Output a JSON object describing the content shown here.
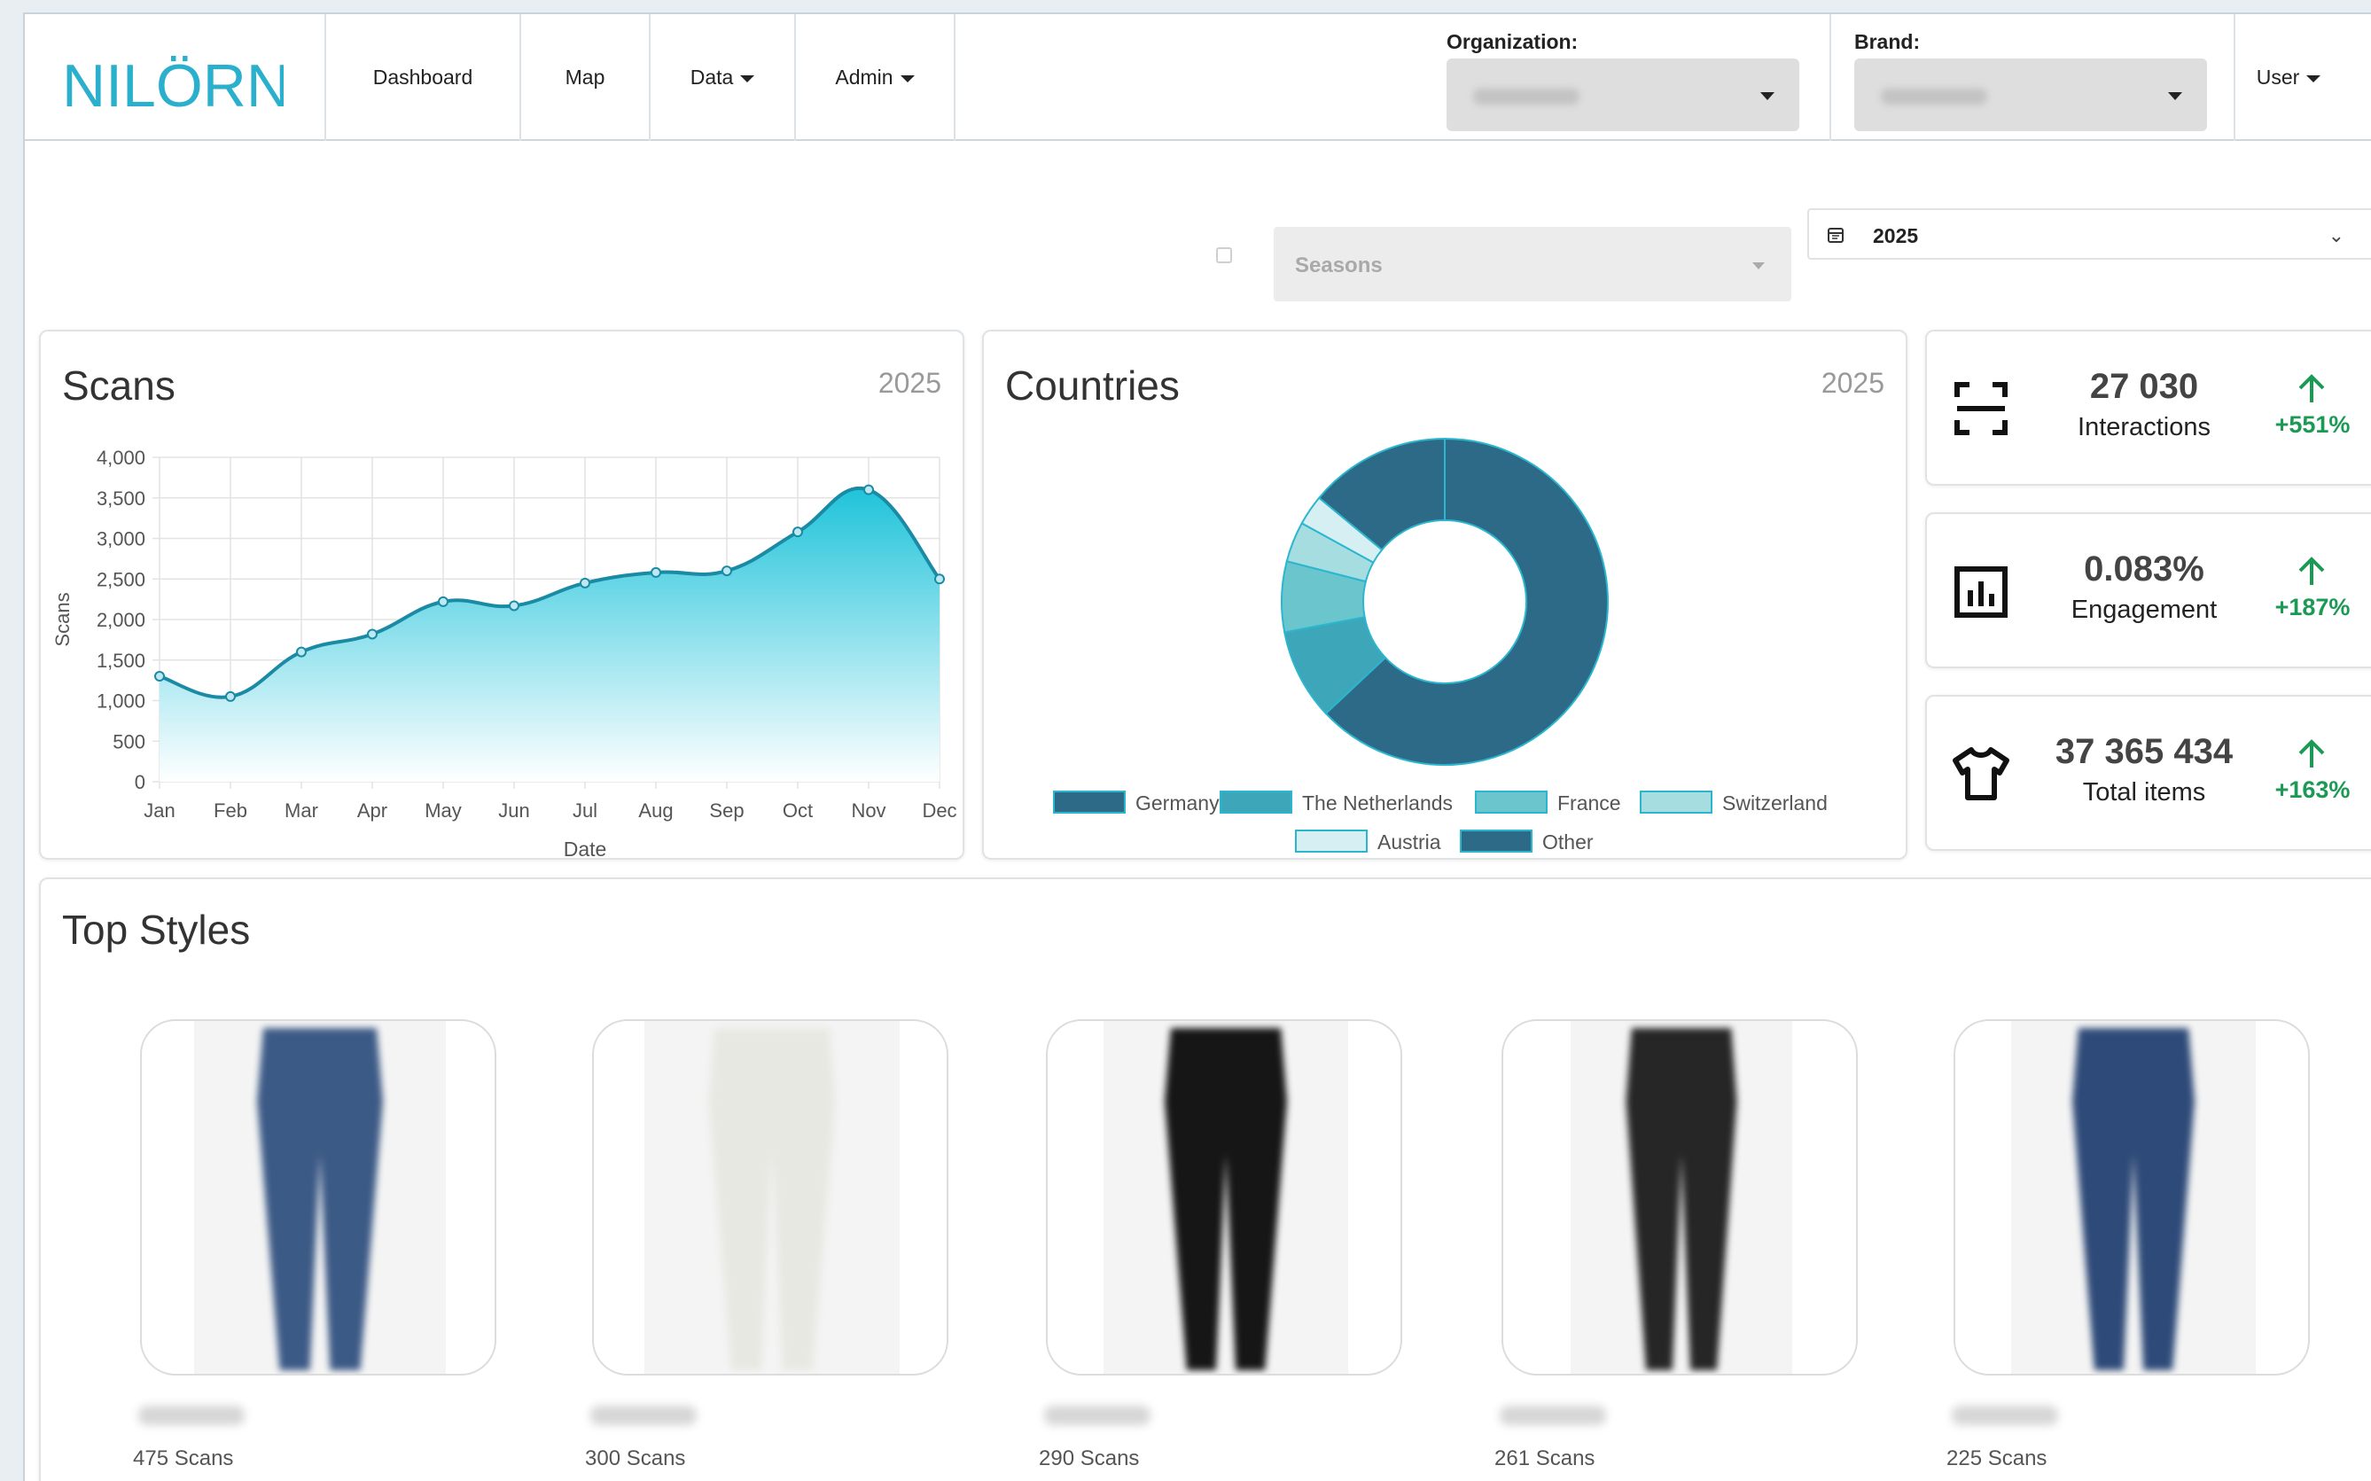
{
  "brand": {
    "logo_text": "NILÖRN",
    "accent": "#2ab0cc"
  },
  "nav": {
    "dashboard": "Dashboard",
    "map": "Map",
    "data": "Data",
    "admin": "Admin",
    "user": "User",
    "organization_label": "Organization:",
    "brand_label": "Brand:"
  },
  "filters": {
    "seasons_placeholder": "Seasons",
    "year": "2025"
  },
  "scans_chart": {
    "title": "Scans",
    "year": "2025",
    "chart_data": {
      "type": "area",
      "categories": [
        "Jan",
        "Feb",
        "Mar",
        "Apr",
        "May",
        "Jun",
        "Jul",
        "Aug",
        "Sep",
        "Oct",
        "Nov",
        "Dec"
      ],
      "values": [
        1300,
        1050,
        1600,
        1820,
        2220,
        2170,
        2450,
        2580,
        2600,
        3080,
        3600,
        2500
      ],
      "xlabel": "Date",
      "ylabel": "Scans",
      "ylim": [
        0,
        4000
      ],
      "yticks": [
        "0",
        "500",
        "1,000",
        "1,500",
        "2,000",
        "2,500",
        "3,000",
        "3,500",
        "4,000"
      ],
      "grid": true,
      "line_color": "#1a8aa5",
      "fill_top": "#1fc3da",
      "fill_bottom": "#ffffff"
    }
  },
  "countries_chart": {
    "title": "Countries",
    "year": "2025",
    "chart_data": {
      "type": "pie",
      "labels": [
        "Germany",
        "The Netherlands",
        "France",
        "Switzerland",
        "Austria",
        "Other"
      ],
      "values": [
        63,
        9,
        7,
        4,
        3,
        14
      ],
      "colors": [
        "#2d6a88",
        "#3ea6b9",
        "#6ac6cc",
        "#a5dde1",
        "#d6eff2",
        "#2d6a88"
      ],
      "legend_position": "bottom"
    }
  },
  "stats": [
    {
      "value": "27 030",
      "label": "Interactions",
      "change": "+551%",
      "icon": "scan-icon"
    },
    {
      "value": "0.083%",
      "label": "Engagement",
      "change": "+187%",
      "icon": "bar-chart-icon"
    },
    {
      "value": "37 365 434",
      "label": "Total items",
      "change": "+163%",
      "icon": "tshirt-icon"
    }
  ],
  "top_styles": {
    "title": "Top Styles",
    "items": [
      {
        "scans": "475 Scans",
        "color": "#3c5a86"
      },
      {
        "scans": "300 Scans",
        "color": "#e8e8e3"
      },
      {
        "scans": "290 Scans",
        "color": "#161616"
      },
      {
        "scans": "261 Scans",
        "color": "#262626"
      },
      {
        "scans": "225 Scans",
        "color": "#2e4a78"
      }
    ]
  }
}
